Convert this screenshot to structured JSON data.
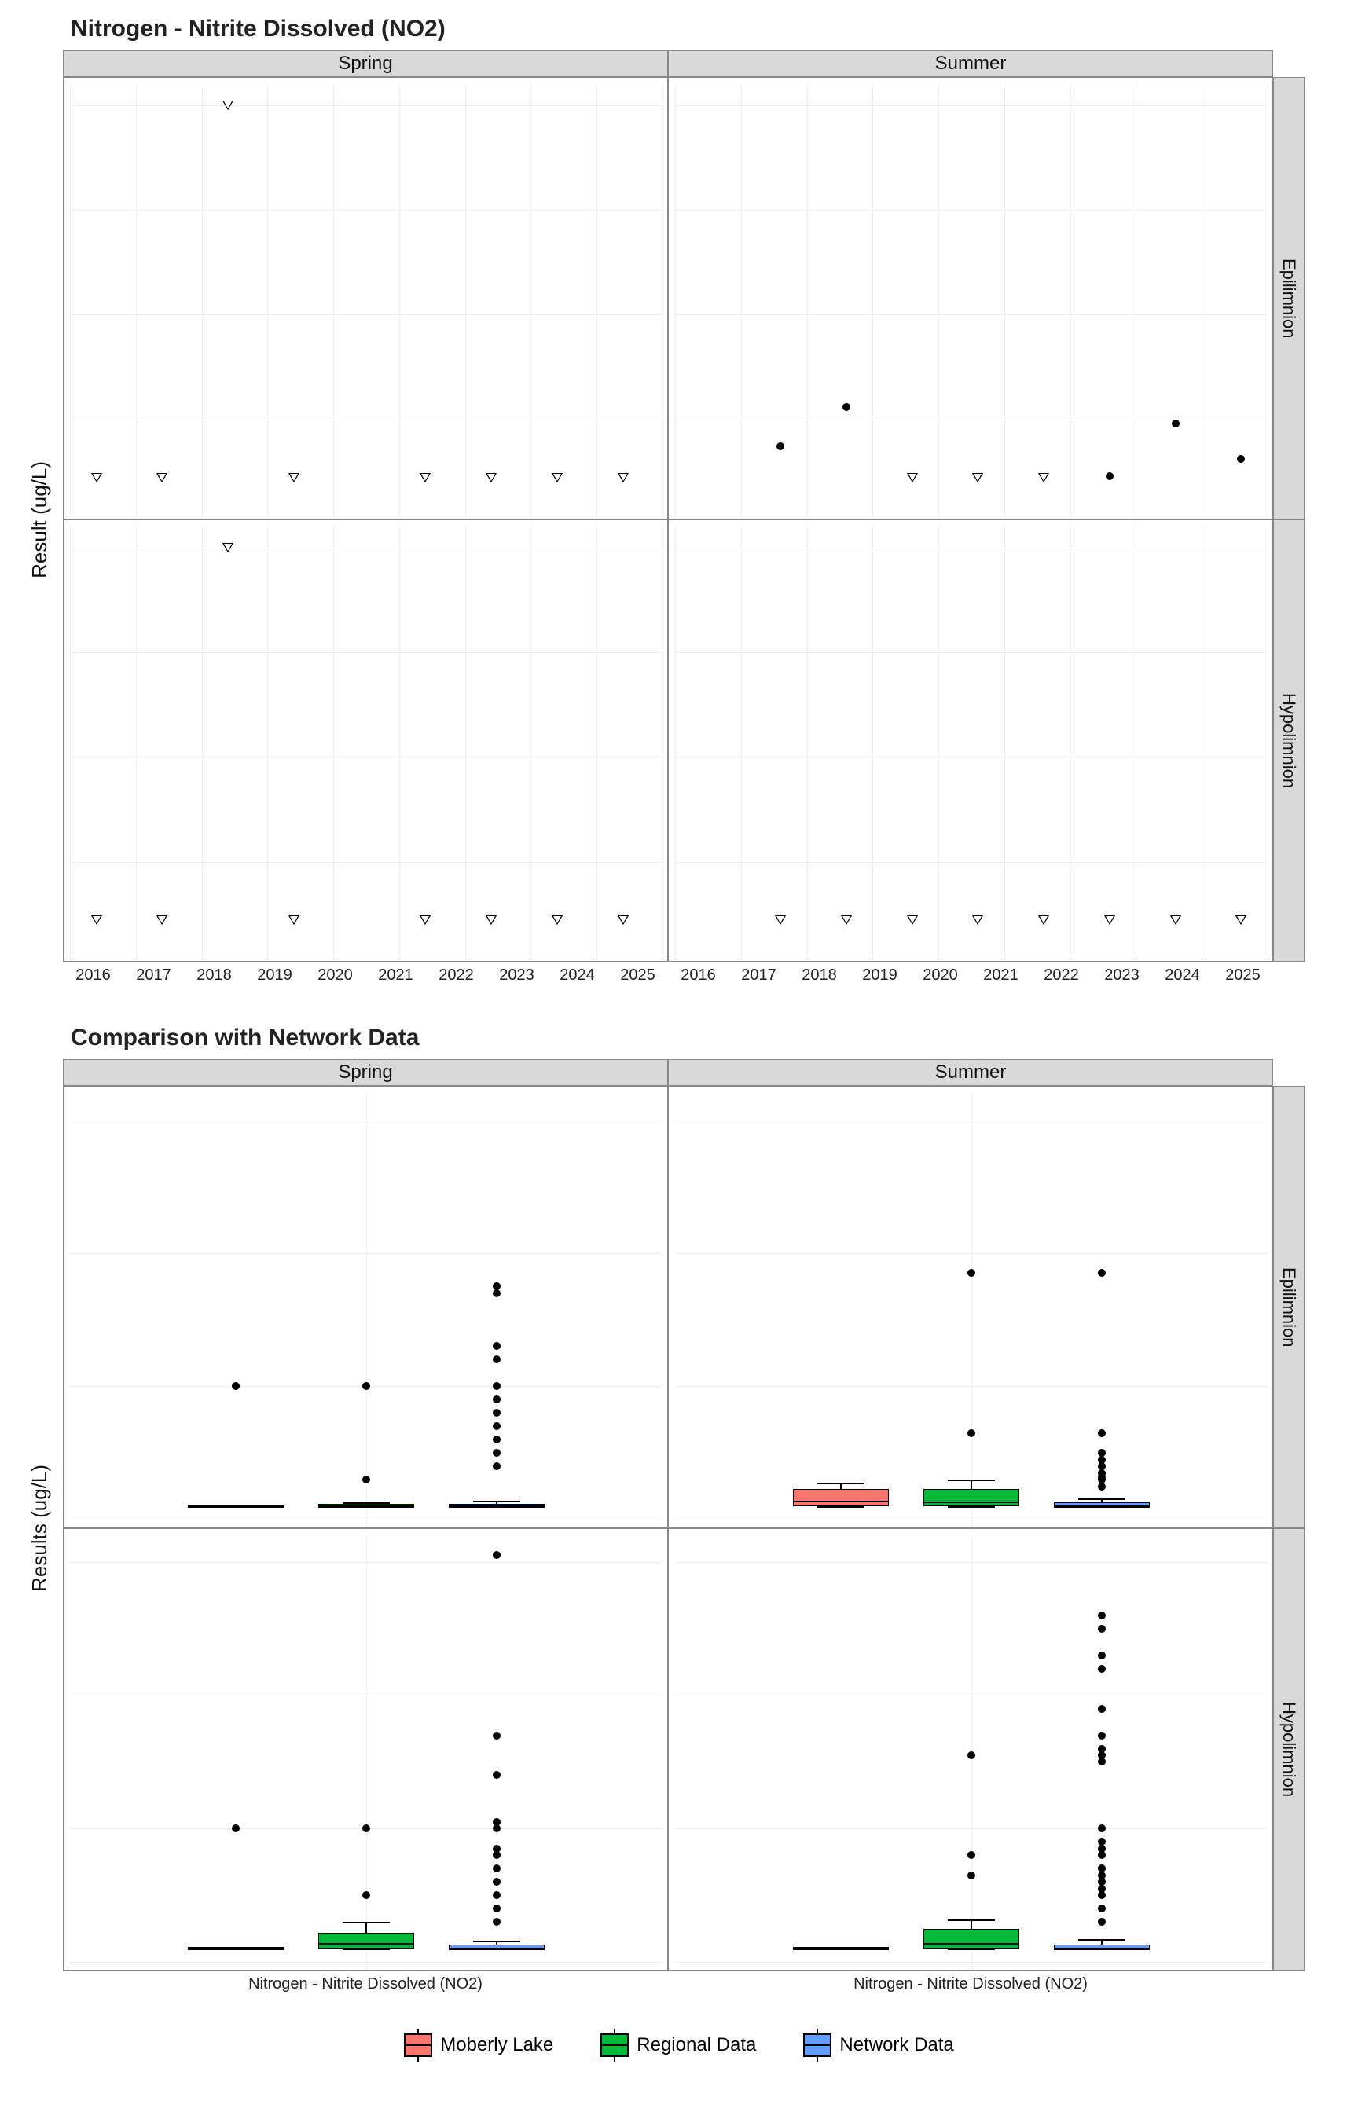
{
  "chart_data": [
    {
      "id": "timeseries",
      "type": "scatter",
      "title": "Nitrogen - Nitrite Dissolved (NO2)",
      "ylabel": "Result (ug/L)",
      "xlabel": "",
      "facet_cols": [
        "Spring",
        "Summer"
      ],
      "facet_rows": [
        "Epilimnion",
        "Hypolimnion"
      ],
      "x_range": [
        2016,
        2025
      ],
      "x_ticks": [
        2016,
        2017,
        2018,
        2019,
        2020,
        2021,
        2022,
        2023,
        2024,
        2025
      ],
      "y_range": [
        0,
        10.5
      ],
      "y_ticks": [
        2.5,
        5.0,
        7.5,
        10.0
      ],
      "panels": {
        "Spring|Epilimnion": [
          {
            "x": 2016.4,
            "y": 1.1,
            "shape": "triangle"
          },
          {
            "x": 2017.4,
            "y": 1.1,
            "shape": "triangle"
          },
          {
            "x": 2018.4,
            "y": 10.0,
            "shape": "triangle"
          },
          {
            "x": 2019.4,
            "y": 1.1,
            "shape": "triangle"
          },
          {
            "x": 2021.4,
            "y": 1.1,
            "shape": "triangle"
          },
          {
            "x": 2022.4,
            "y": 1.1,
            "shape": "triangle"
          },
          {
            "x": 2023.4,
            "y": 1.1,
            "shape": "triangle"
          },
          {
            "x": 2024.4,
            "y": 1.1,
            "shape": "triangle"
          }
        ],
        "Summer|Epilimnion": [
          {
            "x": 2017.6,
            "y": 1.85,
            "shape": "dot"
          },
          {
            "x": 2018.6,
            "y": 2.8,
            "shape": "dot"
          },
          {
            "x": 2019.6,
            "y": 1.1,
            "shape": "triangle"
          },
          {
            "x": 2020.6,
            "y": 1.1,
            "shape": "triangle"
          },
          {
            "x": 2021.6,
            "y": 1.1,
            "shape": "triangle"
          },
          {
            "x": 2022.6,
            "y": 1.15,
            "shape": "dot"
          },
          {
            "x": 2023.6,
            "y": 2.4,
            "shape": "dot"
          },
          {
            "x": 2024.6,
            "y": 1.55,
            "shape": "dot"
          }
        ],
        "Spring|Hypolimnion": [
          {
            "x": 2016.4,
            "y": 1.1,
            "shape": "triangle"
          },
          {
            "x": 2017.4,
            "y": 1.1,
            "shape": "triangle"
          },
          {
            "x": 2018.4,
            "y": 10.0,
            "shape": "triangle"
          },
          {
            "x": 2019.4,
            "y": 1.1,
            "shape": "triangle"
          },
          {
            "x": 2021.4,
            "y": 1.1,
            "shape": "triangle"
          },
          {
            "x": 2022.4,
            "y": 1.1,
            "shape": "triangle"
          },
          {
            "x": 2023.4,
            "y": 1.1,
            "shape": "triangle"
          },
          {
            "x": 2024.4,
            "y": 1.1,
            "shape": "triangle"
          }
        ],
        "Summer|Hypolimnion": [
          {
            "x": 2017.6,
            "y": 1.1,
            "shape": "triangle"
          },
          {
            "x": 2018.6,
            "y": 1.1,
            "shape": "triangle"
          },
          {
            "x": 2019.6,
            "y": 1.1,
            "shape": "triangle"
          },
          {
            "x": 2020.6,
            "y": 1.1,
            "shape": "triangle"
          },
          {
            "x": 2021.6,
            "y": 1.1,
            "shape": "triangle"
          },
          {
            "x": 2022.6,
            "y": 1.1,
            "shape": "triangle"
          },
          {
            "x": 2023.6,
            "y": 1.1,
            "shape": "triangle"
          },
          {
            "x": 2024.6,
            "y": 1.1,
            "shape": "triangle"
          }
        ]
      }
    },
    {
      "id": "boxplots",
      "type": "box",
      "title": "Comparison with Network Data",
      "ylabel": "Results (ug/L)",
      "xlabel": "",
      "facet_cols": [
        "Spring",
        "Summer"
      ],
      "facet_rows": [
        "Epilimnion",
        "Hypolimnion"
      ],
      "x_category": "Nitrogen - Nitrite Dissolved (NO2)",
      "y_range": [
        -1,
        32
      ],
      "y_ticks": [
        0,
        10,
        20,
        30
      ],
      "series_order": [
        "Moberly Lake",
        "Regional Data",
        "Network Data"
      ],
      "series_colors": {
        "Moberly Lake": "#F8766D",
        "Regional Data": "#00BA38",
        "Network Data": "#619CFF"
      },
      "panels": {
        "Spring|Epilimnion": {
          "Moberly Lake": {
            "min": 1.0,
            "q1": 1.0,
            "med": 1.1,
            "q3": 1.1,
            "max": 1.1,
            "out": [
              10.0
            ]
          },
          "Regional Data": {
            "min": 1.0,
            "q1": 1.0,
            "med": 1.1,
            "q3": 1.2,
            "max": 1.3,
            "out": [
              3.0,
              10.0
            ]
          },
          "Network Data": {
            "min": 1.0,
            "q1": 1.0,
            "med": 1.1,
            "q3": 1.2,
            "max": 1.4,
            "out": [
              4,
              5,
              6,
              7,
              8,
              9,
              10,
              12,
              13,
              17,
              17.5
            ]
          }
        },
        "Summer|Epilimnion": {
          "Moberly Lake": {
            "min": 1.0,
            "q1": 1.1,
            "med": 1.5,
            "q3": 2.3,
            "max": 2.8,
            "out": []
          },
          "Regional Data": {
            "min": 1.0,
            "q1": 1.1,
            "med": 1.4,
            "q3": 2.3,
            "max": 3.0,
            "out": [
              6.5,
              18.5
            ]
          },
          "Network Data": {
            "min": 1.0,
            "q1": 1.0,
            "med": 1.1,
            "q3": 1.3,
            "max": 1.6,
            "out": [
              2.5,
              3,
              3.2,
              3.5,
              4,
              4.5,
              5,
              6.5,
              18.5
            ]
          }
        },
        "Spring|Hypolimnion": {
          "Moberly Lake": {
            "min": 1.0,
            "q1": 1.0,
            "med": 1.1,
            "q3": 1.1,
            "max": 1.1,
            "out": [
              10.0
            ]
          },
          "Regional Data": {
            "min": 1.0,
            "q1": 1.1,
            "med": 1.5,
            "q3": 2.2,
            "max": 3.0,
            "out": [
              5.0,
              10.0
            ]
          },
          "Network Data": {
            "min": 1.0,
            "q1": 1.0,
            "med": 1.1,
            "q3": 1.3,
            "max": 1.6,
            "out": [
              3,
              4,
              5,
              6,
              7,
              8,
              8.5,
              10,
              10.5,
              14,
              17,
              30.5
            ]
          }
        },
        "Summer|Hypolimnion": {
          "Moberly Lake": {
            "min": 1.0,
            "q1": 1.0,
            "med": 1.1,
            "q3": 1.1,
            "max": 1.1,
            "out": []
          },
          "Regional Data": {
            "min": 1.0,
            "q1": 1.1,
            "med": 1.5,
            "q3": 2.5,
            "max": 3.2,
            "out": [
              6.5,
              8.0,
              15.5
            ]
          },
          "Network Data": {
            "min": 1.0,
            "q1": 1.0,
            "med": 1.1,
            "q3": 1.3,
            "max": 1.7,
            "out": [
              3,
              4,
              5,
              5.5,
              6,
              6.5,
              7,
              8,
              8.5,
              9,
              10,
              15,
              15.5,
              16,
              17,
              19,
              22,
              23,
              25,
              26
            ]
          }
        }
      }
    }
  ],
  "legend": {
    "items": [
      {
        "label": "Moberly Lake",
        "color": "#F8766D"
      },
      {
        "label": "Regional Data",
        "color": "#00BA38"
      },
      {
        "label": "Network Data",
        "color": "#619CFF"
      }
    ]
  }
}
